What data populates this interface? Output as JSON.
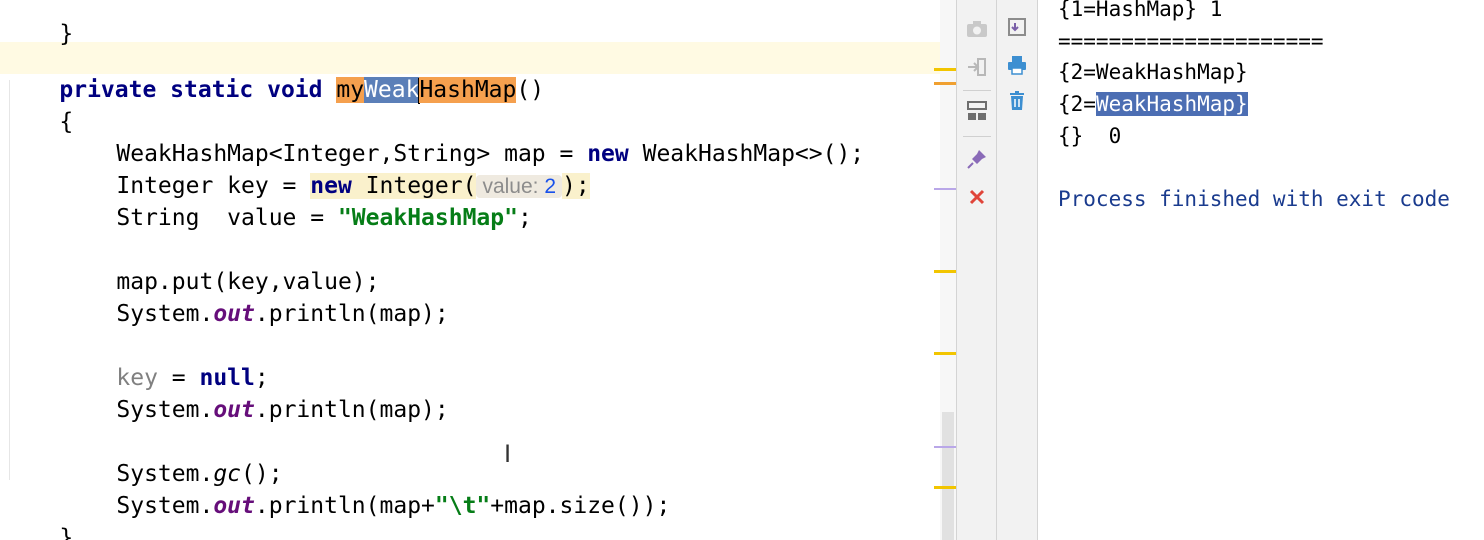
{
  "editor": {
    "signature": {
      "modifiers": "private static void ",
      "name_part1": "my",
      "name_part2": "Weak",
      "name_part3": "HashMap",
      "params": "()"
    },
    "open_brace": "{",
    "close_brace": "}",
    "top_partial": "}",
    "line_map_decl": {
      "type": "WeakHashMap<Integer,String> map = ",
      "kw_new": "new",
      "rest": " WeakHashMap<>();"
    },
    "line_key_decl": {
      "prefix": "Integer key = ",
      "kw_new": "new",
      "ctor": " Integer(",
      "hint_label": "value:",
      "hint_value": "2",
      "suffix": ");"
    },
    "line_value_decl": {
      "prefix": "String  value = ",
      "literal": "\"WeakHashMap\"",
      "suffix": ";"
    },
    "line_put": "map.put(key,value);",
    "line_print1": {
      "prefix": "System.",
      "field": "out",
      "suffix": ".println(map);"
    },
    "line_key_null": {
      "var": "key",
      "middle": " = ",
      "kw_null": "null",
      "suffix": ";"
    },
    "line_print2": {
      "prefix": "System.",
      "field": "out",
      "suffix": ".println(map);"
    },
    "line_gc": {
      "prefix": "System.",
      "method": "gc",
      "suffix": "();"
    },
    "line_print3": {
      "prefix": "System.",
      "field": "out",
      "middle": ".println(map+",
      "literal": "\"\\t\"",
      "suffix": "+map.size());"
    },
    "text_cursor": "I"
  },
  "toolbar_left": {
    "buttons": [
      "camera-icon",
      "sign-in-icon",
      "layout-icon",
      "pin-icon",
      "close-icon"
    ]
  },
  "toolbar_right": {
    "buttons": [
      "soft-wrap-icon",
      "print-icon",
      "trash-icon"
    ]
  },
  "console": {
    "lines": [
      "{1=HashMap} 1",
      "=====================",
      "{2=WeakHashMap}",
      "{2=",
      "{}  0",
      "Process finished with exit code"
    ],
    "selected_fragment": "WeakHashMap}"
  },
  "colors": {
    "keyword": "#000080",
    "string": "#067d17",
    "field": "#660e7a",
    "selection": "#5b7fb8",
    "occurrence": "#f5a04e",
    "caret_row": "#fffae3",
    "process_text": "#1a3b8e"
  }
}
